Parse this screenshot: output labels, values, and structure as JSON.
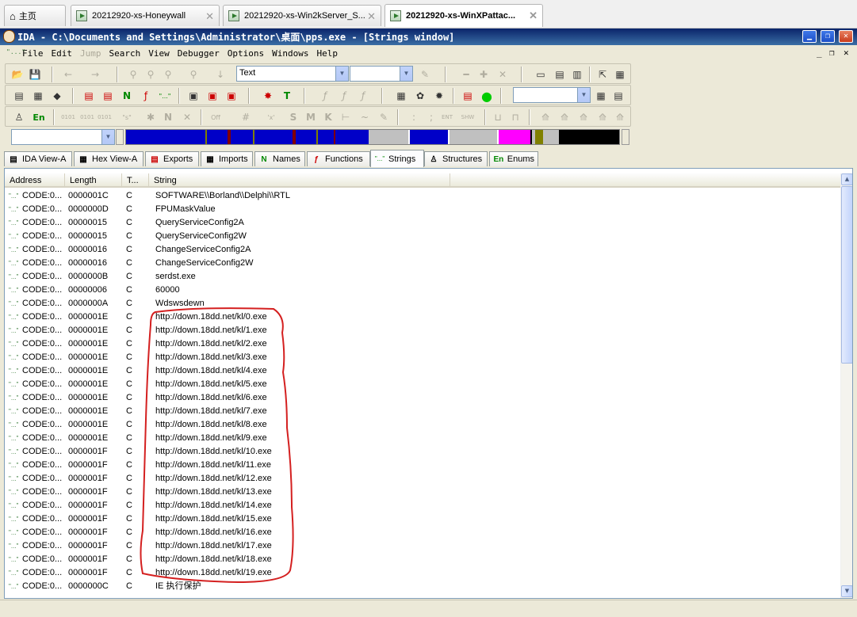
{
  "vm_tabs": [
    {
      "label": "主页",
      "icon": "home-icon"
    },
    {
      "label": "20212920-xs-Honeywall",
      "icon": "vm-icon"
    },
    {
      "label": "20212920-xs-Win2kServer_S...",
      "icon": "vm-icon"
    },
    {
      "label": "20212920-xs-WinXPattac...",
      "icon": "vm-icon",
      "active": true
    }
  ],
  "window": {
    "title": "IDA - C:\\Documents and Settings\\Administrator\\桌面\\pps.exe - [Strings window]"
  },
  "menu": {
    "items": [
      "File",
      "Edit",
      "Jump",
      "Search",
      "View",
      "Debugger",
      "Options",
      "Windows",
      "Help"
    ],
    "disabled": [
      "Jump"
    ]
  },
  "toolbar": {
    "text_combo_value": "Text",
    "en_label": "En"
  },
  "panel_tabs": [
    {
      "label": "IDA View-A",
      "icon": "ida-view-icon"
    },
    {
      "label": "Hex View-A",
      "icon": "hex-view-icon"
    },
    {
      "label": "Exports",
      "icon": "exports-icon"
    },
    {
      "label": "Imports",
      "icon": "imports-icon"
    },
    {
      "label": "Names",
      "icon": "names-icon"
    },
    {
      "label": "Functions",
      "icon": "functions-icon"
    },
    {
      "label": "Strings",
      "icon": "strings-icon",
      "active": true
    },
    {
      "label": "Structures",
      "icon": "structures-icon"
    },
    {
      "label": "Enums",
      "icon": "enums-icon"
    }
  ],
  "strings_table": {
    "columns": [
      "Address",
      "Length",
      "T...",
      "String"
    ],
    "rows": [
      {
        "address": "CODE:0...",
        "length": "0000001C",
        "type": "C",
        "string": "SOFTWARE\\\\Borland\\\\Delphi\\\\RTL"
      },
      {
        "address": "CODE:0...",
        "length": "0000000D",
        "type": "C",
        "string": "FPUMaskValue"
      },
      {
        "address": "CODE:0...",
        "length": "00000015",
        "type": "C",
        "string": "QueryServiceConfig2A"
      },
      {
        "address": "CODE:0...",
        "length": "00000015",
        "type": "C",
        "string": "QueryServiceConfig2W"
      },
      {
        "address": "CODE:0...",
        "length": "00000016",
        "type": "C",
        "string": "ChangeServiceConfig2A"
      },
      {
        "address": "CODE:0...",
        "length": "00000016",
        "type": "C",
        "string": "ChangeServiceConfig2W"
      },
      {
        "address": "CODE:0...",
        "length": "0000000B",
        "type": "C",
        "string": "serdst.exe"
      },
      {
        "address": "CODE:0...",
        "length": "00000006",
        "type": "C",
        "string": "60000"
      },
      {
        "address": "CODE:0...",
        "length": "0000000A",
        "type": "C",
        "string": "Wdswsdewn"
      },
      {
        "address": "CODE:0...",
        "length": "0000001E",
        "type": "C",
        "string": "http://down.18dd.net/kl/0.exe"
      },
      {
        "address": "CODE:0...",
        "length": "0000001E",
        "type": "C",
        "string": "http://down.18dd.net/kl/1.exe"
      },
      {
        "address": "CODE:0...",
        "length": "0000001E",
        "type": "C",
        "string": "http://down.18dd.net/kl/2.exe"
      },
      {
        "address": "CODE:0...",
        "length": "0000001E",
        "type": "C",
        "string": "http://down.18dd.net/kl/3.exe"
      },
      {
        "address": "CODE:0...",
        "length": "0000001E",
        "type": "C",
        "string": "http://down.18dd.net/kl/4.exe"
      },
      {
        "address": "CODE:0...",
        "length": "0000001E",
        "type": "C",
        "string": "http://down.18dd.net/kl/5.exe"
      },
      {
        "address": "CODE:0...",
        "length": "0000001E",
        "type": "C",
        "string": "http://down.18dd.net/kl/6.exe"
      },
      {
        "address": "CODE:0...",
        "length": "0000001E",
        "type": "C",
        "string": "http://down.18dd.net/kl/7.exe"
      },
      {
        "address": "CODE:0...",
        "length": "0000001E",
        "type": "C",
        "string": "http://down.18dd.net/kl/8.exe"
      },
      {
        "address": "CODE:0...",
        "length": "0000001E",
        "type": "C",
        "string": "http://down.18dd.net/kl/9.exe"
      },
      {
        "address": "CODE:0...",
        "length": "0000001F",
        "type": "C",
        "string": "http://down.18dd.net/kl/10.exe"
      },
      {
        "address": "CODE:0...",
        "length": "0000001F",
        "type": "C",
        "string": "http://down.18dd.net/kl/11.exe"
      },
      {
        "address": "CODE:0...",
        "length": "0000001F",
        "type": "C",
        "string": "http://down.18dd.net/kl/12.exe"
      },
      {
        "address": "CODE:0...",
        "length": "0000001F",
        "type": "C",
        "string": "http://down.18dd.net/kl/13.exe"
      },
      {
        "address": "CODE:0...",
        "length": "0000001F",
        "type": "C",
        "string": "http://down.18dd.net/kl/14.exe"
      },
      {
        "address": "CODE:0...",
        "length": "0000001F",
        "type": "C",
        "string": "http://down.18dd.net/kl/15.exe"
      },
      {
        "address": "CODE:0...",
        "length": "0000001F",
        "type": "C",
        "string": "http://down.18dd.net/kl/16.exe"
      },
      {
        "address": "CODE:0...",
        "length": "0000001F",
        "type": "C",
        "string": "http://down.18dd.net/kl/17.exe"
      },
      {
        "address": "CODE:0...",
        "length": "0000001F",
        "type": "C",
        "string": "http://down.18dd.net/kl/18.exe"
      },
      {
        "address": "CODE:0...",
        "length": "0000001F",
        "type": "C",
        "string": "http://down.18dd.net/kl/19.exe"
      },
      {
        "address": "CODE:0...",
        "length": "0000000C",
        "type": "C",
        "string": "IE 执行保护"
      }
    ]
  },
  "colors": {
    "titlebar": "#0a246a",
    "nav_code": "#0000c8",
    "annotation": "#d42020"
  }
}
